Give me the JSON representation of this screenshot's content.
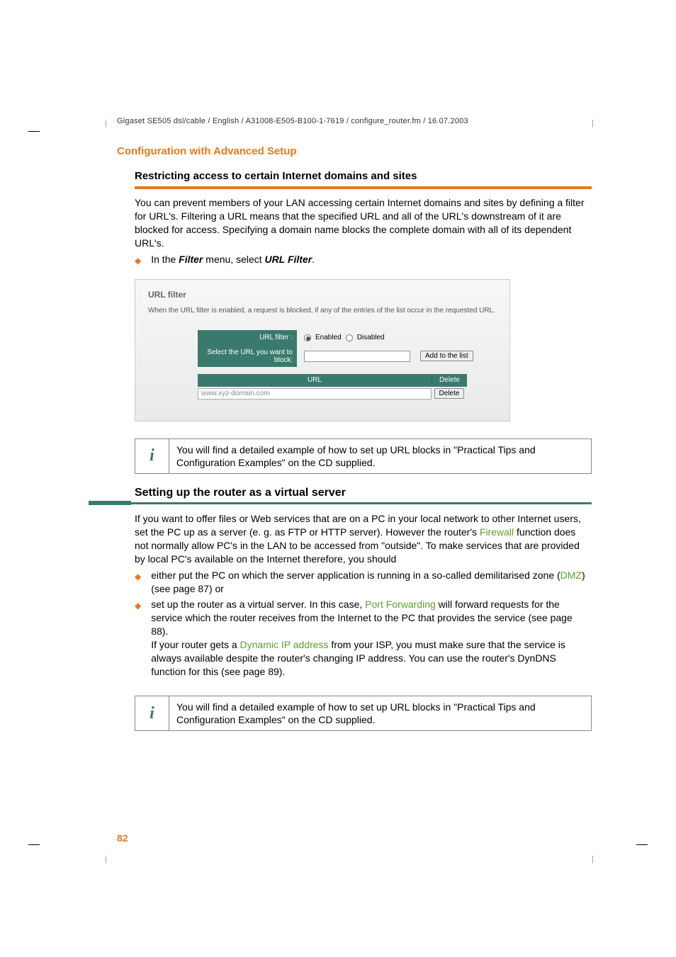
{
  "header": {
    "path": "Gigaset SE505 dsl/cable / English / A31008-E505-B100-1-7619 / configure_router.fm / 16.07.2003"
  },
  "title": "Configuration with Advanced Setup",
  "section1": {
    "heading": "Restricting access to certain Internet domains and sites",
    "para": "You can prevent members of your LAN accessing certain Internet domains and sites by defining a filter for URL's. Filtering a URL means that the specified URL and all of the URL's downstream of it are blocked for access. Specifying a domain name blocks the complete domain with all of its dependent URL's.",
    "bullet_prefix": "In the ",
    "bullet_bold1": "Filter",
    "bullet_mid": " menu, select ",
    "bullet_bold2": "URL Filter",
    "bullet_suffix": "."
  },
  "screenshot": {
    "title": "URL filter",
    "desc": "When the URL filter is enabled, a request is blocked, if any of the entries of the list occur in the requested URL.",
    "label_filter": "URL filter :",
    "opt_enabled": "Enabled",
    "opt_disabled": "Disabled",
    "label_select": "Select the URL you want to block:",
    "btn_add": "Add to the list",
    "col_url": "URL",
    "col_delete": "Delete",
    "example_url": "www.xyz-domain.com",
    "btn_delete": "Delete"
  },
  "info1": "You will find a detailed example of how to set up URL blocks in \"Practical Tips and Configuration Examples\" on the CD supplied.",
  "section2": {
    "heading": "Setting up the router as a virtual server",
    "para1_a": "If you want to offer files or Web services that are on a PC in your local network to other Internet users, set the PC up as a server (e. g. as FTP or HTTP server). However the router's ",
    "para1_link1": "Firewall",
    "para1_b": " function does not normally allow PC's in the LAN to be accessed from \"outside\". To make services that are provided by local PC's available on the Internet therefore, you should",
    "bullet1_a": "either put the PC on which the server application is running in a so-called demilitarised zone (",
    "bullet1_link": "DMZ",
    "bullet1_b": ") (see page 87) or",
    "bullet2_a": "set up the router as a virtual server. In this case, ",
    "bullet2_link": "Port Forwarding",
    "bullet2_b": " will forward requests for the service which the router receives from the Internet to the PC that provides the service (see page 88).",
    "bullet2_c": "If your router gets a ",
    "bullet2_link2": "Dynamic IP address",
    "bullet2_d": " from your ISP, you must make sure that the service is always available despite the router's changing IP address. You can use the router's DynDNS function for this (see page 89)."
  },
  "info2": "You will find a detailed example of how to set up URL blocks in \"Practical Tips and Configuration Examples\" on the CD supplied.",
  "page_number": "82"
}
